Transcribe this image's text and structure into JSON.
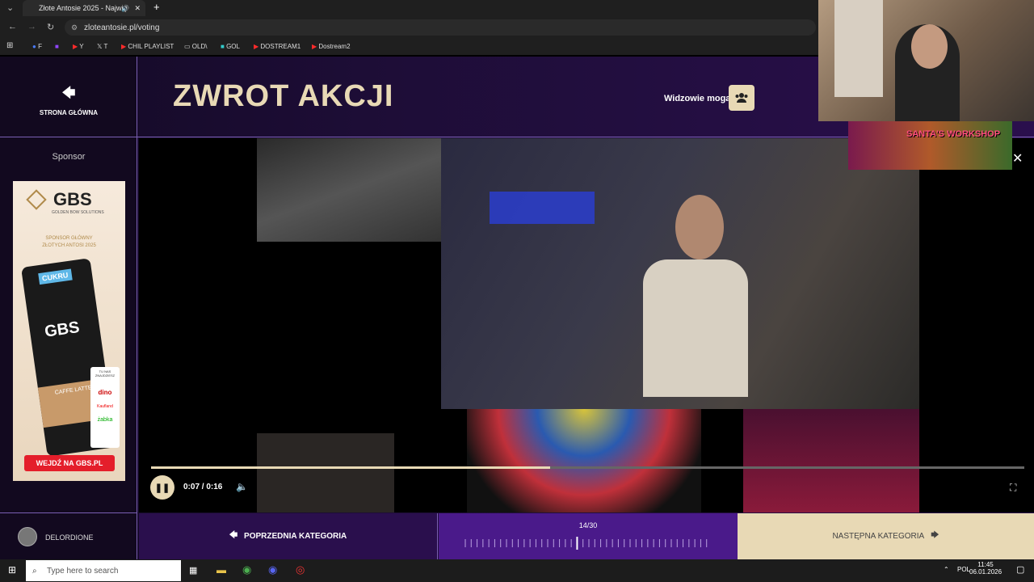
{
  "browser": {
    "tab_title": "Złote Antosie 2025 - Najwię",
    "url": "zloteantosie.pl/voting",
    "bookmarks": [
      "F",
      "Y",
      "T",
      "CHIL PLAYLIST",
      "OLD\\",
      "GOL",
      "DOSTREAM1",
      "Dostream2"
    ]
  },
  "header": {
    "home_label": "STRONA GŁÓWNA",
    "title": "ZWROT AKCJI",
    "viewers_label": "Widzowie mogą"
  },
  "sidebar": {
    "sponsor_label": "Sponsor",
    "ad": {
      "brand": "GBS",
      "brand_sub": "GOLDEN BOW SOLUTIONS",
      "tagline_1": "SPONSOR GŁÓWNY",
      "tagline_2": "ZŁOTYCH ANTOSI 2025",
      "can_label": "CUKRU",
      "can_product": "CAFFE LATTE",
      "shops_title": "TU NAS ZNAJDZIESZ",
      "shops": [
        "dino",
        "Kaufland",
        "żabka"
      ],
      "cta": "WEJDŹ NA GBS.PL"
    }
  },
  "player": {
    "time": "0:07 / 0:16",
    "progress": 0.457
  },
  "footer": {
    "username": "DELORDIONE",
    "prev_label": "POPRZEDNIA KATEGORIA",
    "count": "14/30",
    "next_label": "NASTĘPNA KATEGORIA"
  },
  "overlay": {
    "banner_text": "SANTA'S WORKSHOP"
  },
  "taskbar": {
    "search_placeholder": "Type here to search",
    "lang": "POL",
    "time": "11:45",
    "date": "06.01.2026"
  },
  "colors": {
    "accent_gold": "#e8d9b5",
    "purple_dark": "#12091f",
    "purple_mid": "#4a1a8a",
    "divider": "#7a5fb3"
  }
}
